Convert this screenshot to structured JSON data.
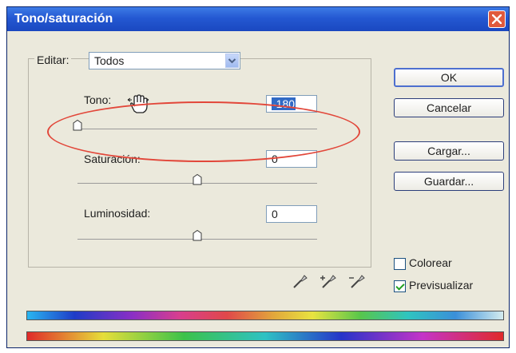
{
  "window": {
    "title": "Tono/saturación"
  },
  "edit": {
    "label": "Editar:",
    "selected": "Todos"
  },
  "hue": {
    "label": "Tono:",
    "value": "-180",
    "slider_fraction": 0.0
  },
  "saturation": {
    "label": "Saturación:",
    "value": "0",
    "slider_fraction": 0.5
  },
  "lightness": {
    "label": "Luminosidad:",
    "value": "0",
    "slider_fraction": 0.5
  },
  "buttons": {
    "ok": "OK",
    "cancel": "Cancelar",
    "load": "Cargar...",
    "save": "Guardar..."
  },
  "options": {
    "colorize": "Colorear",
    "colorize_checked": false,
    "preview": "Previsualizar",
    "preview_checked": true
  },
  "icons": [
    "hand-cursor-icon",
    "eyedropper-icon",
    "eyedropper-plus-icon",
    "eyedropper-minus-icon",
    "close-icon",
    "chevron-down-icon"
  ],
  "colors": {
    "titlebar": "#2458d2",
    "close_button": "#e05a3d",
    "highlight_oval": "#e2473a",
    "selection": "#316ac5"
  }
}
